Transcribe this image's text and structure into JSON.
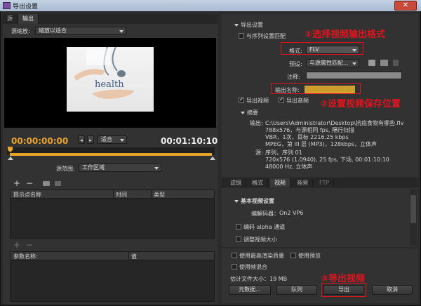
{
  "window": {
    "title": "导出设置",
    "close_label": "✕"
  },
  "left_tabs": [
    "源",
    "输出"
  ],
  "source_scale": {
    "label": "源缩放:",
    "value": "缩放以适合"
  },
  "preview_image": {
    "caption": "health"
  },
  "timeline": {
    "current": "00:00:00:00",
    "fit": "适合",
    "duration": "00:01:10:10"
  },
  "source_range": {
    "label": "源范围:",
    "value": "工作区域"
  },
  "cue_table": {
    "col_name": "提示点名称",
    "col_time": "时间",
    "col_type": "类型"
  },
  "param_table": {
    "col_name": "参数名称:",
    "col_value": "值"
  },
  "export_settings": {
    "header": "导出设置",
    "match_sequence": "与序列设置匹配",
    "format_label": "格式:",
    "format_value": "FLV",
    "preset_label": "预设:",
    "preset_value": "与源属性匹配...",
    "comment_label": "注释:",
    "output_name_label": "输出名称:",
    "output_name_value": "抗癌食物有哪些.flv",
    "export_video": "导出视频",
    "export_audio": "导出音频"
  },
  "summary": {
    "header": "摘要",
    "output_label": "输出:",
    "output_lines": [
      "C:\\Users\\Administrator\\Desktop\\抗癌食物有哪些.flv",
      "788x576，与源相同 fps, 隔行扫描",
      "VBR，1次，目标 2216.25 kbps",
      "MPEG，第 III 层 (MP3)，128kbps，立体声"
    ],
    "source_label": "源:",
    "source_lines": [
      "序列，序列 01",
      "720x576 (1.0940), 25 fps, 下场, 00:01:10:10",
      "48000 Hz, 立体声"
    ]
  },
  "bottom_tabs": [
    "滤镜",
    "格式",
    "视频",
    "音频",
    "FTP"
  ],
  "video_basic": {
    "header": "基本视频设置",
    "codec_label": "编解码器：",
    "codec_value": "On2 VP6",
    "alpha": "编码 alpha 通道",
    "resize": "调整视频大小"
  },
  "options": {
    "max_quality": "使用最高渲染质量",
    "use_preview": "使用预览",
    "frame_blend": "使用帧混合",
    "est_size": "估计文件大小：19 MB"
  },
  "buttons": {
    "metadata": "元数据...",
    "queue": "队列",
    "export": "导出",
    "cancel": "取消"
  },
  "annotations": {
    "a1": "①选择视频输出格式",
    "a2": "②设置视频保存位置",
    "a3": "③导出视频"
  },
  "colors": {
    "accent": "#e8a32c",
    "annotation": "#e0141e",
    "highlight": "#c9a238"
  }
}
